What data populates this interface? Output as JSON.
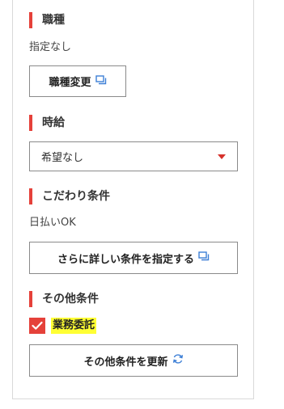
{
  "job_type": {
    "heading": "職種",
    "value": "指定なし",
    "change_button": "職種変更"
  },
  "hourly_wage": {
    "heading": "時給",
    "selected": "希望なし"
  },
  "preferences": {
    "heading": "こだわり条件",
    "value": "日払いOK",
    "detail_button": "さらに詳しい条件を指定する"
  },
  "other_conditions": {
    "heading": "その他条件",
    "checkbox_label": "業務委託",
    "checkbox_checked": true,
    "update_button": "その他条件を更新"
  },
  "colors": {
    "accent_red": "#e5413a",
    "highlight_yellow": "#ffff33",
    "icon_blue": "#3d7fd6"
  },
  "icons": {
    "external_window": "external-window-icon",
    "refresh": "refresh-icon",
    "dropdown": "dropdown-caret-icon",
    "check": "check-icon"
  }
}
